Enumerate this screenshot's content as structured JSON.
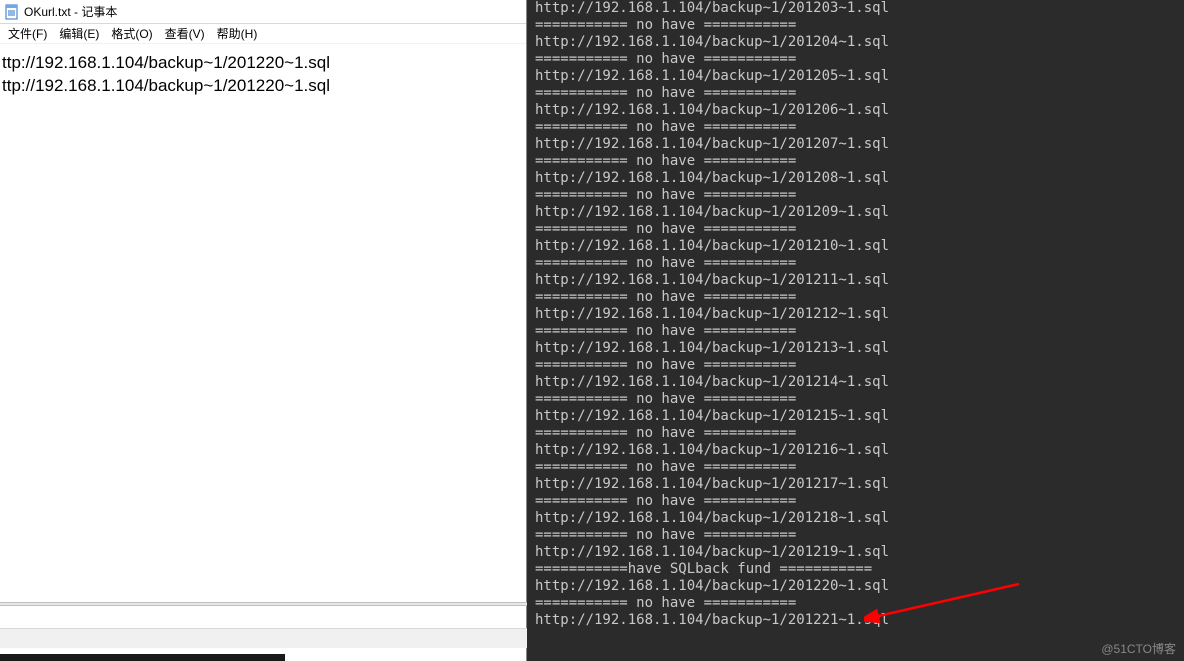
{
  "notepad": {
    "title_text": "OKurl.txt - 记事本",
    "menus": [
      {
        "label": "文件(F)"
      },
      {
        "label": "编辑(E)"
      },
      {
        "label": "格式(O)"
      },
      {
        "label": "查看(V)"
      },
      {
        "label": "帮助(H)"
      }
    ],
    "content_lines": [
      "ttp://192.168.1.104/backup~1/201220~1.sql",
      "ttp://192.168.1.104/backup~1/201220~1.sql"
    ],
    "status": ""
  },
  "terminal": {
    "base_url": "http://192.168.1.104/backup~1/",
    "suffix": "~1.sql",
    "nohave": "=========== no have ===========",
    "found": "===========have SQLback fund ===========",
    "entries": [
      {
        "n": "201203",
        "hit": false
      },
      {
        "n": "201204",
        "hit": false
      },
      {
        "n": "201205",
        "hit": false
      },
      {
        "n": "201206",
        "hit": false
      },
      {
        "n": "201207",
        "hit": false
      },
      {
        "n": "201208",
        "hit": false
      },
      {
        "n": "201209",
        "hit": false
      },
      {
        "n": "201210",
        "hit": false
      },
      {
        "n": "201211",
        "hit": false
      },
      {
        "n": "201212",
        "hit": false
      },
      {
        "n": "201213",
        "hit": false
      },
      {
        "n": "201214",
        "hit": false
      },
      {
        "n": "201215",
        "hit": false
      },
      {
        "n": "201216",
        "hit": false
      },
      {
        "n": "201217",
        "hit": false
      },
      {
        "n": "201218",
        "hit": false
      },
      {
        "n": "201219",
        "hit": true
      },
      {
        "n": "201220",
        "hit": false
      },
      {
        "n": "201221",
        "hit": null
      }
    ]
  },
  "watermark": "@51CTO博客"
}
